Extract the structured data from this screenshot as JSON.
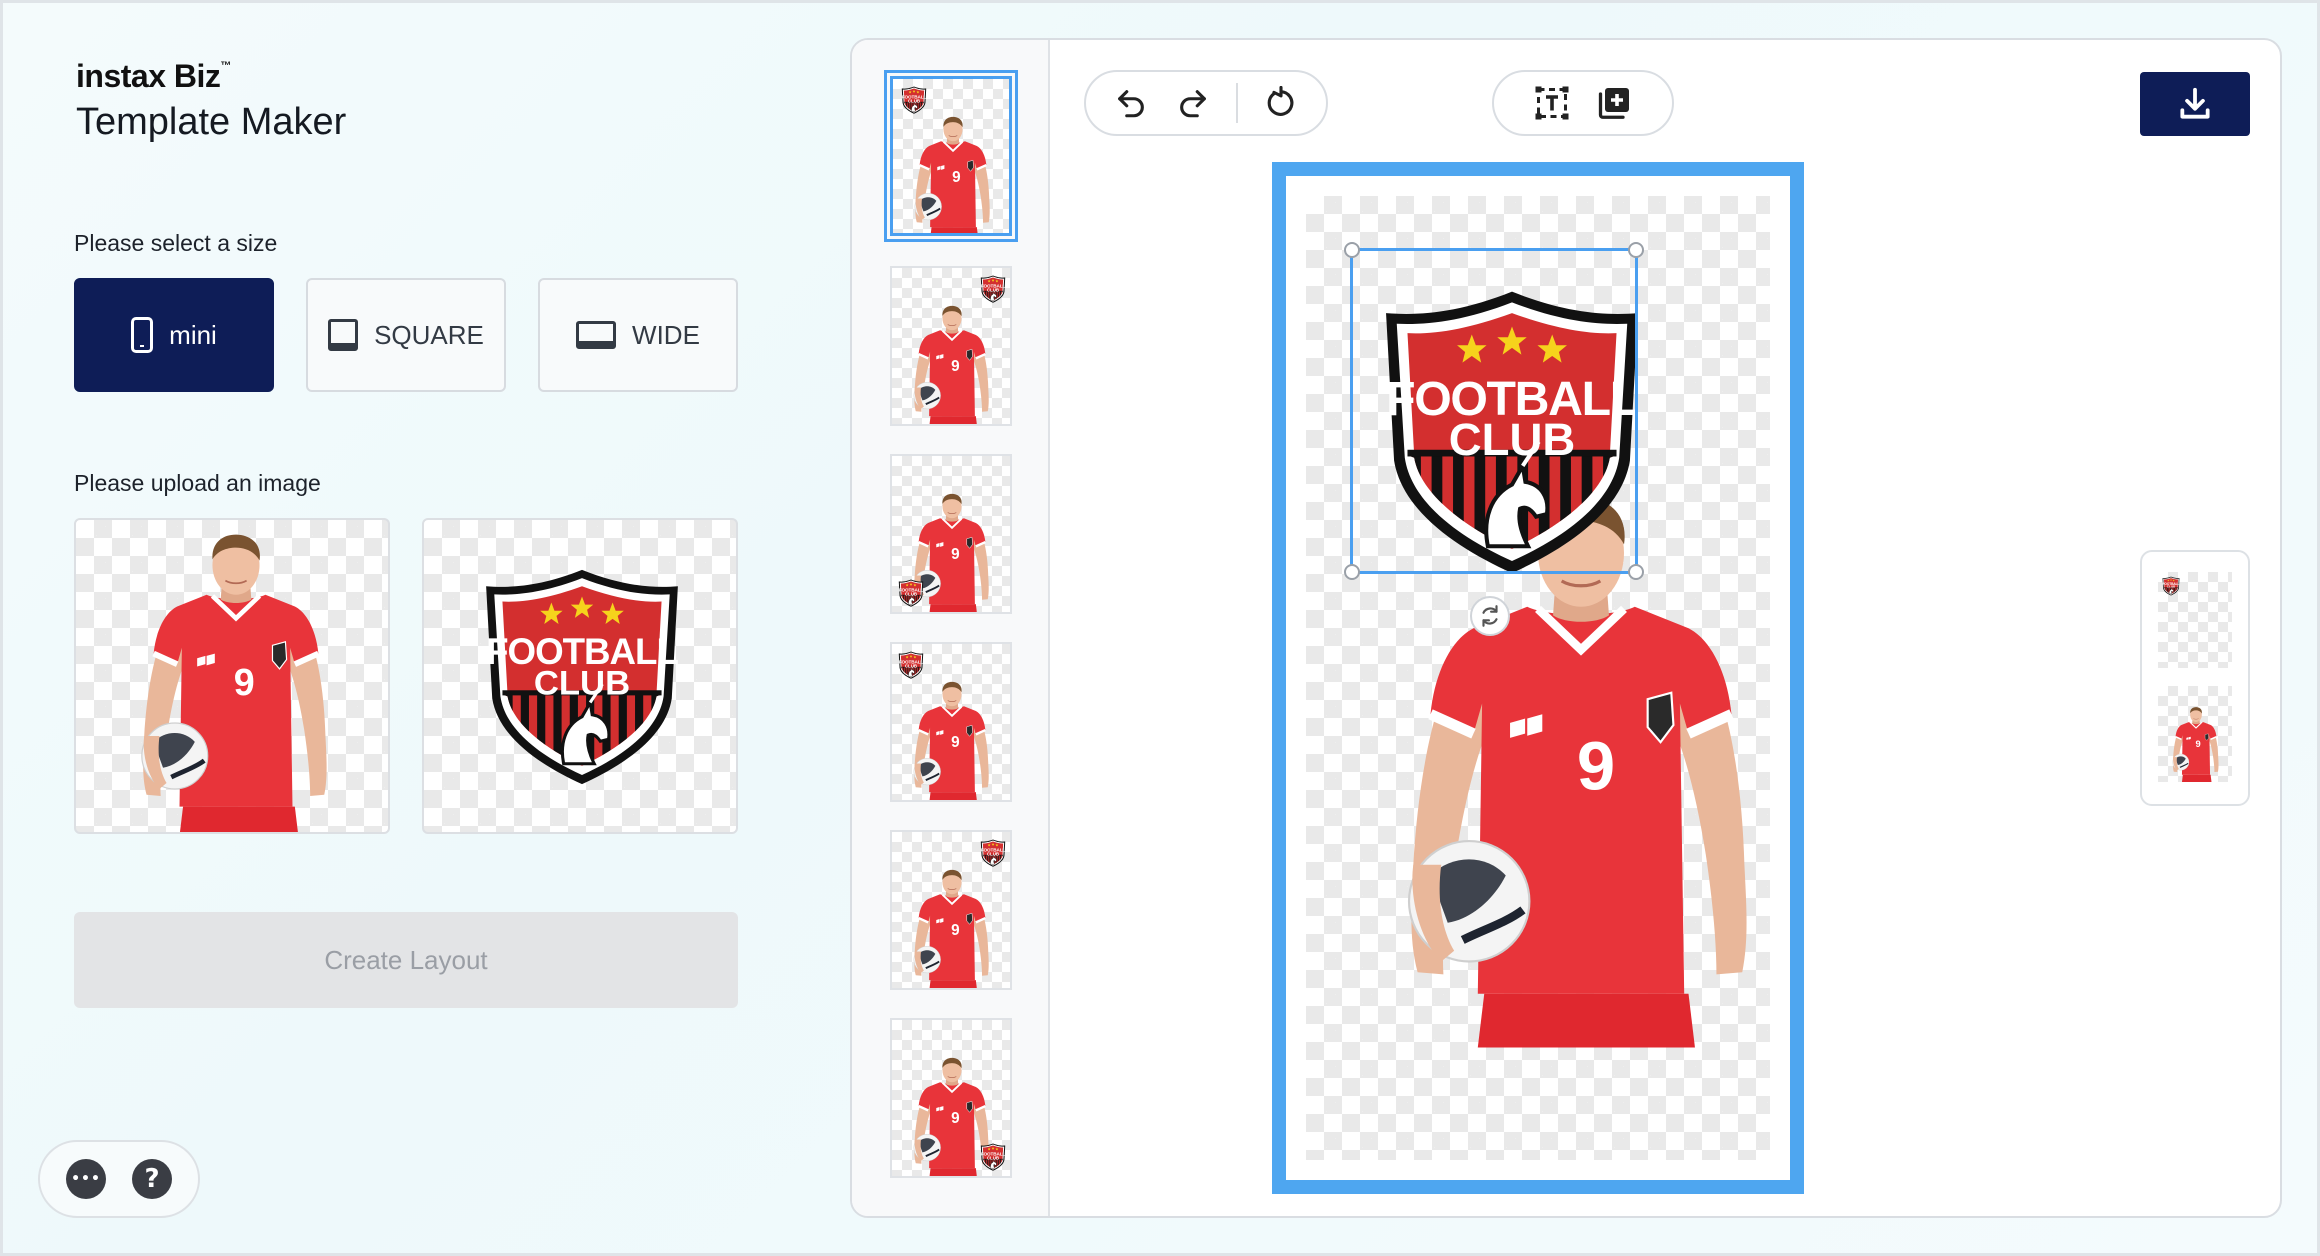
{
  "app": {
    "brand": "instax Biz",
    "brand_tm": "™",
    "title": "Template Maker"
  },
  "size_section": {
    "label": "Please select a size",
    "options": [
      {
        "label": "mini",
        "icon": "phone-icon",
        "selected": true
      },
      {
        "label": "SQUARE",
        "icon": "square-icon",
        "selected": false
      },
      {
        "label": "WIDE",
        "icon": "wide-icon",
        "selected": false
      }
    ]
  },
  "upload_section": {
    "label": "Please upload an image",
    "images": [
      {
        "name": "player-photo"
      },
      {
        "name": "football-club-logo"
      }
    ]
  },
  "create_button": {
    "label": "Create Layout",
    "enabled": false
  },
  "help": {
    "more": "•••",
    "question": "?"
  },
  "logo": {
    "line1": "FOOTBALL",
    "line2": "CLUB"
  },
  "jersey_number": "9",
  "layout_thumbnails": {
    "count": 6,
    "selected_index": 0,
    "logo_positions": [
      "top-left",
      "top-right",
      "bottom-left",
      "top-left",
      "top-right",
      "bottom-right"
    ]
  },
  "toolbar": {
    "undo": "undo-icon",
    "redo": "redo-icon",
    "reset": "reset-icon",
    "add_text": "add-text-icon",
    "add_image": "add-image-icon",
    "download": "download-icon"
  },
  "colors": {
    "navy": "#0e1d57",
    "selection_blue": "#4a9ff0",
    "jersey_red": "#e8343a",
    "logo_red": "#d32f2f"
  }
}
